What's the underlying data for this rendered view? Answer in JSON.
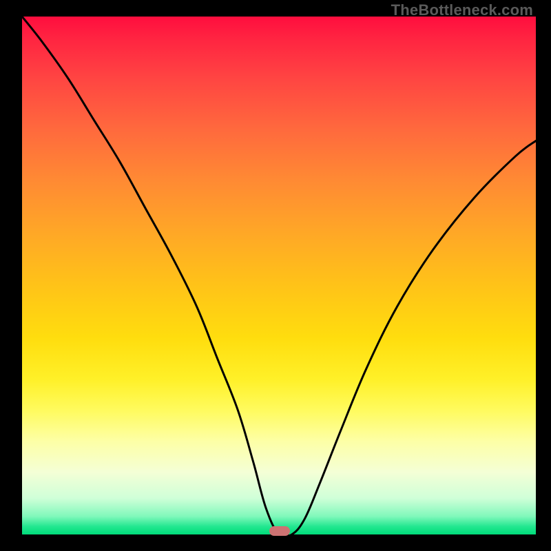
{
  "watermark": "TheBottleneck.com",
  "colors": {
    "marker": "#cd7272",
    "curve": "#000000",
    "frame": "#000000"
  },
  "marker": {
    "x_pct": 50.2,
    "y_pct": 99.3
  },
  "chart_data": {
    "type": "line",
    "title": "",
    "xlabel": "",
    "ylabel": "",
    "xlim": [
      0,
      100
    ],
    "ylim": [
      0,
      100
    ],
    "grid": false,
    "series": [
      {
        "name": "bottleneck-curve",
        "x": [
          0,
          4,
          9,
          14,
          19,
          24,
          29,
          34,
          38,
          42,
          45,
          47.5,
          50,
          52.5,
          55,
          58,
          62,
          67,
          73,
          80,
          88,
          96,
          100
        ],
        "y": [
          100,
          95,
          88,
          80,
          72,
          63,
          54,
          44,
          34,
          24,
          14,
          5,
          0,
          0,
          3,
          10,
          20,
          32,
          44,
          55,
          65,
          73,
          76
        ]
      }
    ],
    "annotations": [
      {
        "type": "marker",
        "shape": "pill",
        "x": 50.2,
        "y": 0.7,
        "color": "#cd7272"
      }
    ],
    "background_gradient": {
      "direction": "vertical",
      "stops": [
        {
          "pct": 0,
          "color": "#ff0d3e"
        },
        {
          "pct": 22,
          "color": "#ff6a3d"
        },
        {
          "pct": 52,
          "color": "#ffc318"
        },
        {
          "pct": 76,
          "color": "#fffb5e"
        },
        {
          "pct": 100,
          "color": "#00dc7a"
        }
      ]
    }
  }
}
